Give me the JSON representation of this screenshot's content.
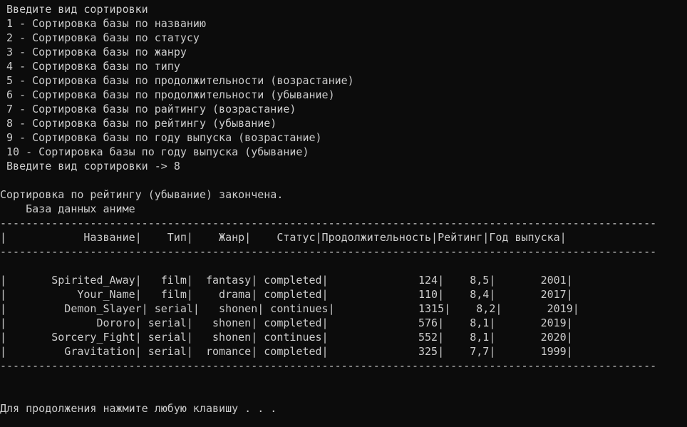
{
  "menu": {
    "header": " Введите вид сортировки",
    "options": [
      " 1 - Сортировка базы по названию",
      " 2 - Сортировка базы по статусу",
      " 3 - Сортировка базы по жанру",
      " 4 - Сортировка базы по типу",
      " 5 - Сортировка базы по продолжительности (возрастание)",
      " 6 - Сортировка базы по продолжительности (убывание)",
      " 7 - Сортировка базы по райтингу (возрастание)",
      " 8 - Сортировка базы по рейтингу (убывание)",
      " 9 - Сортировка базы по году выпуска (возрастание)",
      " 10 - Сортировка базы по году выпуска (убывание)"
    ],
    "prompt": " Введите вид сортировки -> 8"
  },
  "result": {
    "done_message": "Сортировка по рейтингу (убывание) закончена.",
    "db_title": "    База данных аниме"
  },
  "table": {
    "separator": "------------------------------------------------------------------------------------------------------",
    "header_row": "|            Название|    Тип|    Жанр|    Статус|Продолжительность|Рейтинг|Год выпуска|",
    "rows": [
      "|       Spirited_Away|   film|  fantasy| completed|              124|    8,5|       2001|",
      "|           Your_Name|   film|    drama| completed|              110|    8,4|       2017|",
      "|         Demon_Slayer| serial|   shonen| continues|             1315|    8,2|       2019|",
      "|              Dororo| serial|   shonen| completed|              576|    8,1|       2019|",
      "|       Sorcery_Fight| serial|   shonen| continues|              552|    8,1|       2020|",
      "|         Gravitation| serial|  romance| completed|              325|    7,7|       1999|"
    ]
  },
  "footer": {
    "press_key": "Для продолжения нажмите любую клавишу . . ."
  }
}
